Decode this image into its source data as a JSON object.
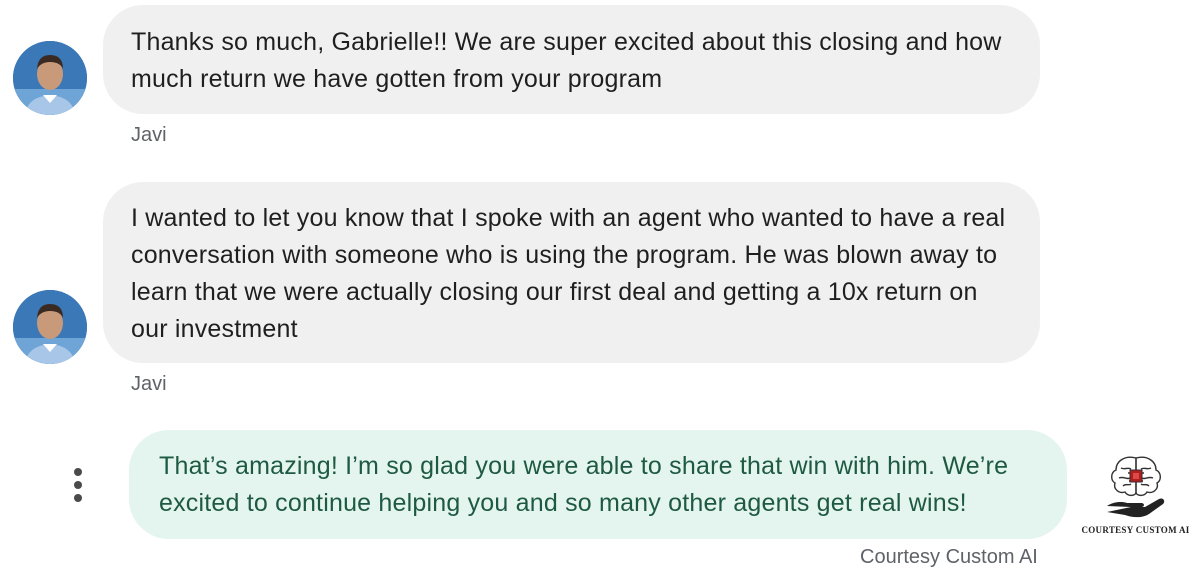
{
  "messages": [
    {
      "direction": "incoming",
      "text": "Thanks so much, Gabrielle!! We are super excited about this closing and how much return we have gotten from your program",
      "sender": "Javi"
    },
    {
      "direction": "incoming",
      "text": "I wanted to let you know that I spoke with an agent who wanted to have a real conversation with someone who is using the program. He was blown away to learn that we were actually closing our first deal and getting a 10x return on our investment",
      "sender": "Javi"
    },
    {
      "direction": "outgoing",
      "text": "That’s amazing! I’m so glad you were able to share that win with him. We’re excited to continue helping you and so many other agents get real wins!"
    }
  ],
  "icons": {
    "message_options": "more-vertical-icon",
    "watermark_logo": "brain-hand-icon"
  },
  "watermark": {
    "text": "COURTESY CUSTOM AI"
  },
  "caption": "Courtesy Custom AI",
  "colors": {
    "incoming_bubble": "#f0f0f0",
    "outgoing_bubble": "#e4f4ee",
    "outgoing_text": "#1e5a43",
    "sender_text": "#5f6368"
  }
}
